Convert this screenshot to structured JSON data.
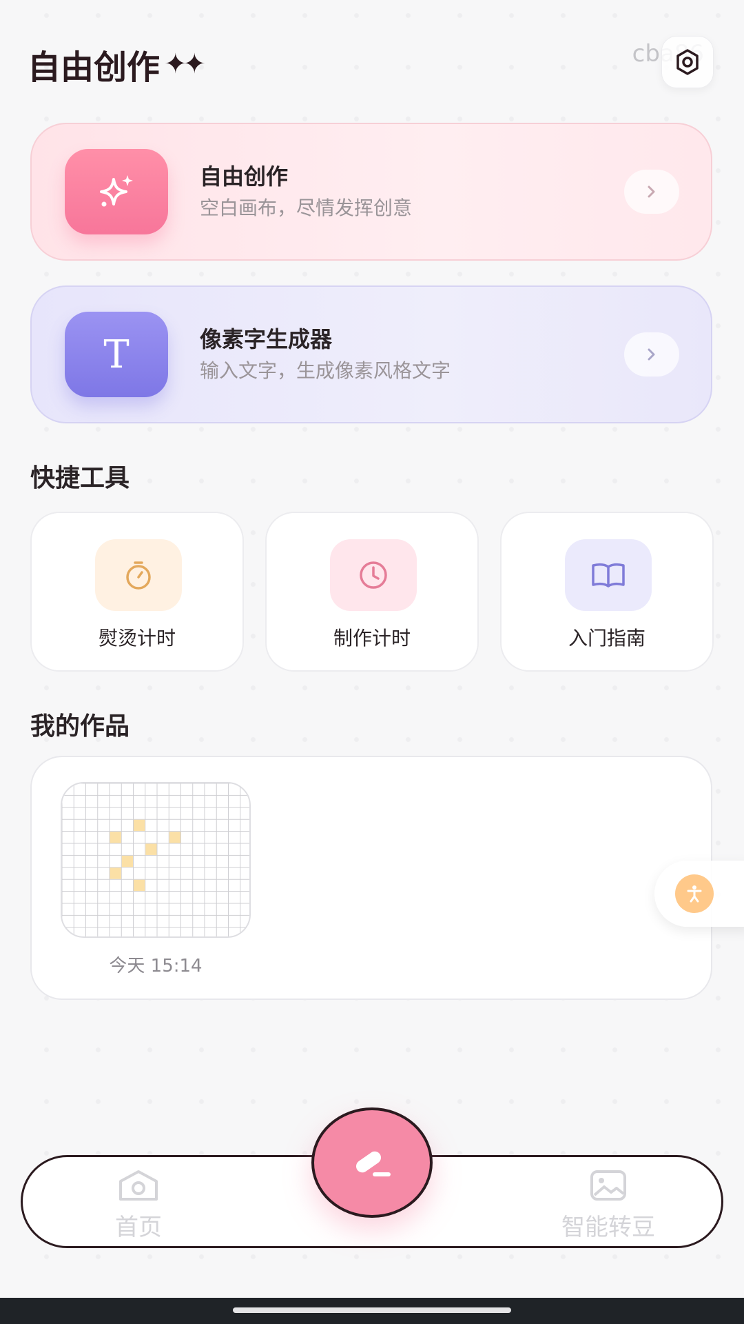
{
  "header": {
    "title": "自由创作",
    "sparkles": "✦✦",
    "user_tag": "cba86",
    "settings_icon": "settings-hexagon-icon"
  },
  "features": [
    {
      "title": "自由创作",
      "subtitle": "空白画布，尽情发挥创意",
      "icon": "sparkle-icon",
      "accent": "#f7769a"
    },
    {
      "title": "像素字生成器",
      "subtitle": "输入文字，生成像素风格文字",
      "icon": "text-t-icon",
      "icon_text": "T",
      "accent": "#7e77e6"
    }
  ],
  "quick_tools": {
    "title": "快捷工具",
    "items": [
      {
        "label": "熨烫计时",
        "icon": "stopwatch-icon",
        "color": "#e3a85c",
        "bg": "#fff1e2"
      },
      {
        "label": "制作计时",
        "icon": "clock-icon",
        "color": "#e57c97",
        "bg": "#ffe6ec"
      },
      {
        "label": "入门指南",
        "icon": "book-icon",
        "color": "#7f7bd8",
        "bg": "#ebeafc"
      }
    ]
  },
  "my_works": {
    "title": "我的作品",
    "items": [
      {
        "time": "今天 15:14",
        "pixel_color": "#fbe0a6"
      }
    ]
  },
  "bottom_nav": {
    "home_label": "首页",
    "convert_label": "智能转豆",
    "fab_icon": "eraser-icon"
  },
  "accessibility_icon": "accessibility-icon"
}
